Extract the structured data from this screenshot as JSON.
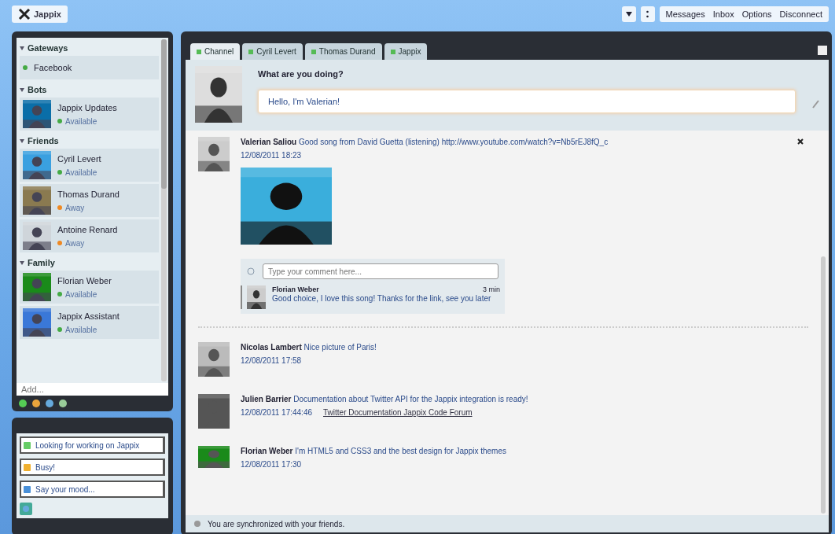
{
  "header": {
    "logo": "Jappix",
    "links": [
      "Messages",
      "Inbox",
      "Options",
      "Disconnect"
    ]
  },
  "roster": {
    "groups": [
      {
        "name": "Gateways",
        "expanded": true,
        "contacts": [
          {
            "kind": "gateway",
            "name": "Facebook",
            "color": "#44aa44"
          }
        ]
      },
      {
        "name": "Bots",
        "expanded": true,
        "contacts": [
          {
            "kind": "buddy",
            "name": "Jappix Updates",
            "status": "Available",
            "color": "#44aa44"
          }
        ]
      },
      {
        "name": "Friends",
        "expanded": true,
        "contacts": [
          {
            "kind": "buddy",
            "name": "Cyril Levert",
            "status": "Available",
            "color": "#44aa44"
          },
          {
            "kind": "buddy",
            "name": "Thomas Durand",
            "status": "Away",
            "color": "#ee8822"
          },
          {
            "kind": "buddy",
            "name": "Antoine Renard",
            "status": "Away",
            "color": "#ee8822"
          }
        ]
      },
      {
        "name": "Family",
        "expanded": true,
        "contacts": [
          {
            "kind": "buddy",
            "name": "Florian Weber",
            "status": "Available",
            "color": "#44aa44"
          },
          {
            "kind": "buddy",
            "name": "Jappix Assistant",
            "status": "Available",
            "color": "#44aa44"
          }
        ]
      }
    ],
    "search": {
      "placeholder": "Add..."
    }
  },
  "presence": {
    "fields": [
      "Looking for working on Jappix",
      "Busy!",
      "Say your mood..."
    ]
  },
  "tabs": [
    {
      "label": "Channel",
      "selected": true
    },
    {
      "label": "Cyril Levert",
      "selected": false
    },
    {
      "label": "Thomas Durand",
      "selected": false
    },
    {
      "label": "Jappix",
      "selected": false
    }
  ],
  "composer": {
    "question": "What are you doing?",
    "value": "Hello, I'm Valerian!"
  },
  "posts": [
    {
      "author": "Valerian Saliou",
      "text": "Good song from David Guetta (listening) http://www.youtube.com/watch?v=Nb5rEJ8fQ_c",
      "date": "12/08/2011 18:23",
      "media": true,
      "comment_placeholder": "Type your comment here...",
      "comments": [
        {
          "author": "Florian Weber",
          "time": "3 min",
          "text": "Good choice, I love this song! Thanks for the link, see you later"
        }
      ]
    },
    {
      "author": "Nicolas Lambert",
      "text": "Nice picture of Paris!",
      "date": "12/08/2011 17:58"
    },
    {
      "author": "Julien Barrier",
      "text": "Documentation about Twitter API for the Jappix integration is ready!",
      "date": "12/08/2011 17:44:46",
      "link": "Twitter Documentation Jappix Code Forum"
    },
    {
      "author": "Florian Weber",
      "text": "I'm HTML5 and CSS3 and the best design for Jappix themes",
      "date": "12/08/2011 17:30"
    }
  ],
  "footer": "You are synchronized with your friends."
}
